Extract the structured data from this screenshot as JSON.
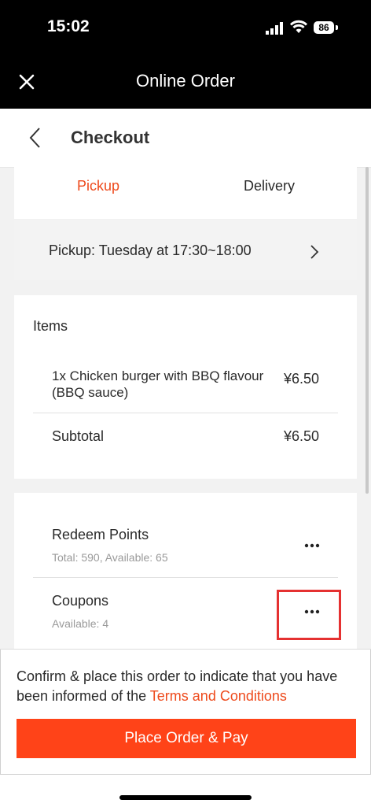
{
  "status": {
    "time": "15:02",
    "battery": "86"
  },
  "header": {
    "title": "Online Order"
  },
  "nav": {
    "title": "Checkout"
  },
  "tabs": [
    {
      "label": "Pickup",
      "active": true
    },
    {
      "label": "Delivery",
      "active": false
    }
  ],
  "pickup": {
    "label": "Pickup: Tuesday at 17:30~18:00"
  },
  "items": {
    "title": "Items",
    "list": [
      {
        "name": "1x Chicken burger with BBQ flavour (BBQ sauce)",
        "price": "¥6.50"
      }
    ],
    "subtotal_label": "Subtotal",
    "subtotal_value": "¥6.50"
  },
  "discounts": {
    "points_title": "Redeem Points",
    "points_sub": "Total: 590, Available: 65",
    "coupons_title": "Coupons",
    "coupons_sub": "Available: 4"
  },
  "footer": {
    "confirm_text": "Confirm & place this order to indicate that you have been informed of the ",
    "terms_link": "Terms and Conditions",
    "button": "Place Order & Pay"
  },
  "colors": {
    "accent": "#ee4a1c",
    "button": "#ff4318",
    "highlight": "#e53131"
  },
  "icons": [
    "close-icon",
    "chevron-left-icon",
    "chevron-right-icon",
    "more-icon",
    "signal-icon",
    "wifi-icon",
    "battery-icon"
  ]
}
